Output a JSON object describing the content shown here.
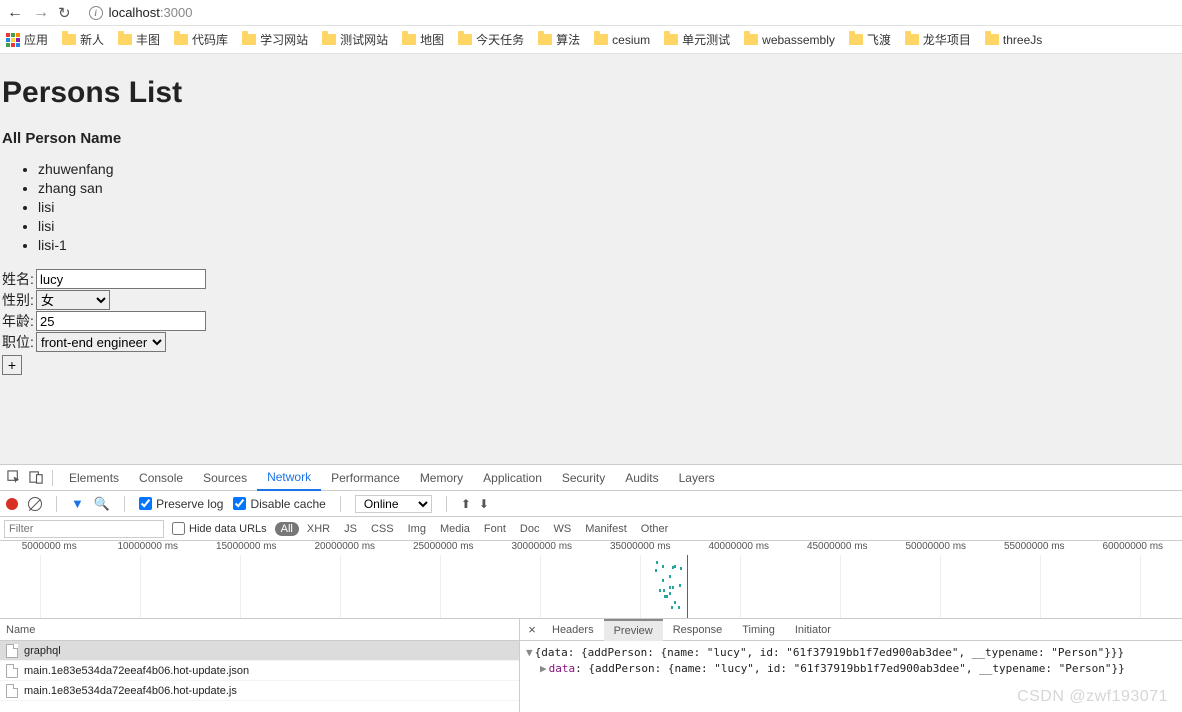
{
  "browser": {
    "url_host": "localhost",
    "url_port": ":3000"
  },
  "bookmarks": {
    "apps": "应用",
    "items": [
      "新人",
      "丰图",
      "代码库",
      "学习网站",
      "测试网站",
      "地图",
      "今天任务",
      "算法",
      "cesium",
      "单元测试",
      "webassembly",
      "飞渡",
      "龙华项目",
      "threeJs"
    ]
  },
  "page": {
    "title": "Persons List",
    "subtitle": "All Person Name",
    "persons": [
      "zhuwenfang",
      "zhang san",
      "lisi",
      "lisi",
      "lisi-1"
    ],
    "form": {
      "name_label": "姓名:",
      "name_value": "lucy",
      "gender_label": "性别:",
      "gender_value": "女",
      "age_label": "年龄:",
      "age_value": "25",
      "job_label": "职位:",
      "job_value": "front-end engineer",
      "add_label": "+"
    }
  },
  "devtools": {
    "tabs": [
      "Elements",
      "Console",
      "Sources",
      "Network",
      "Performance",
      "Memory",
      "Application",
      "Security",
      "Audits",
      "Layers"
    ],
    "active_tab": "Network",
    "toolbar": {
      "preserve": "Preserve log",
      "disable_cache": "Disable cache",
      "online": "Online"
    },
    "filter": {
      "placeholder": "Filter",
      "hide_urls": "Hide data URLs",
      "types": [
        "All",
        "XHR",
        "JS",
        "CSS",
        "Img",
        "Media",
        "Font",
        "Doc",
        "WS",
        "Manifest",
        "Other"
      ]
    },
    "timeline_labels": [
      "5000000 ms",
      "10000000 ms",
      "15000000 ms",
      "20000000 ms",
      "25000000 ms",
      "30000000 ms",
      "35000000 ms",
      "40000000 ms",
      "45000000 ms",
      "50000000 ms",
      "55000000 ms",
      "60000000 ms"
    ],
    "requests": {
      "header": "Name",
      "rows": [
        "graphql",
        "main.1e83e534da72eeaf4b06.hot-update.json",
        "main.1e83e534da72eeaf4b06.hot-update.js"
      ]
    },
    "response": {
      "tabs": [
        "Headers",
        "Preview",
        "Response",
        "Timing",
        "Initiator"
      ],
      "active": "Preview",
      "line1_pre": "{data: {addPerson: {name: \"",
      "line1_name": "lucy",
      "line1_mid": "\", id: \"",
      "line1_id": "61f37919bb1f7ed900ab3dee",
      "line1_post": "\", __typename: \"Person\"}}}",
      "line2_key": "data",
      "line2_body": ": {addPerson: {name: \"lucy\", id: \"61f37919bb1f7ed900ab3dee\", __typename: \"Person\"}}"
    }
  },
  "watermark": "CSDN @zwf193071"
}
